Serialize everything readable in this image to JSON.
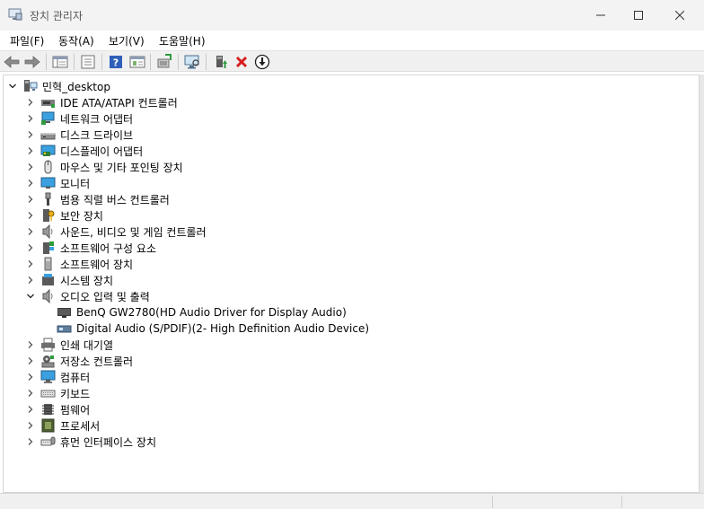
{
  "window": {
    "title": "장치 관리자",
    "min_glyph": "—",
    "max_glyph": "☐",
    "close_glyph": "✕"
  },
  "menu": [
    "파일(F)",
    "동작(A)",
    "보기(V)",
    "도움말(H)"
  ],
  "toolbar_icons": [
    "back-arrow-icon",
    "forward-arrow-icon",
    "show-hide-tree-icon",
    "properties-icon",
    "help-icon",
    "view-icon",
    "update-driver-icon",
    "scan-hardware-icon",
    "enable-device-icon",
    "uninstall-icon",
    "disable-device-icon"
  ],
  "tree": {
    "root": "민혁_desktop",
    "categories": [
      {
        "label": "IDE ATA/ATAPI 컨트롤러",
        "icon": "ide-controller-icon",
        "expanded": false
      },
      {
        "label": "네트워크 어댑터",
        "icon": "network-adapter-icon",
        "expanded": false
      },
      {
        "label": "디스크 드라이브",
        "icon": "disk-drive-icon",
        "expanded": false
      },
      {
        "label": "디스플레이 어댑터",
        "icon": "display-adapter-icon",
        "expanded": false
      },
      {
        "label": "마우스 및 기타 포인팅 장치",
        "icon": "mouse-icon",
        "expanded": false
      },
      {
        "label": "모니터",
        "icon": "monitor-icon",
        "expanded": false
      },
      {
        "label": "범용 직렬 버스 컨트롤러",
        "icon": "usb-icon",
        "expanded": false
      },
      {
        "label": "보안 장치",
        "icon": "security-device-icon",
        "expanded": false
      },
      {
        "label": "사운드, 비디오 및 게임 컨트롤러",
        "icon": "speaker-icon",
        "expanded": false
      },
      {
        "label": "소프트웨어 구성 요소",
        "icon": "software-component-icon",
        "expanded": false
      },
      {
        "label": "소프트웨어 장치",
        "icon": "software-device-icon",
        "expanded": false
      },
      {
        "label": "시스템 장치",
        "icon": "system-device-icon",
        "expanded": false
      },
      {
        "label": "오디오 입력 및 출력",
        "icon": "speaker-icon",
        "expanded": true,
        "children": [
          {
            "label": "BenQ GW2780(HD Audio Driver for Display Audio)",
            "icon": "display-audio-icon"
          },
          {
            "label": "Digital Audio (S/PDIF)(2- High Definition Audio Device)",
            "icon": "spdif-audio-icon"
          }
        ]
      },
      {
        "label": "인쇄 대기열",
        "icon": "printer-icon",
        "expanded": false
      },
      {
        "label": "저장소 컨트롤러",
        "icon": "storage-controller-icon",
        "expanded": false
      },
      {
        "label": "컴퓨터",
        "icon": "computer-icon",
        "expanded": false
      },
      {
        "label": "키보드",
        "icon": "keyboard-icon",
        "expanded": false
      },
      {
        "label": "펌웨어",
        "icon": "firmware-icon",
        "expanded": false
      },
      {
        "label": "프로세서",
        "icon": "processor-icon",
        "expanded": false
      },
      {
        "label": "휴먼 인터페이스 장치",
        "icon": "hid-icon",
        "expanded": false
      }
    ]
  },
  "colors": {
    "titlebar": "#f3f3f3",
    "toolbar": "#f0f0f0",
    "uninstall_red": "#d81e1e",
    "help_blue": "#2f5fb8",
    "update_green": "#2e9b3e"
  }
}
